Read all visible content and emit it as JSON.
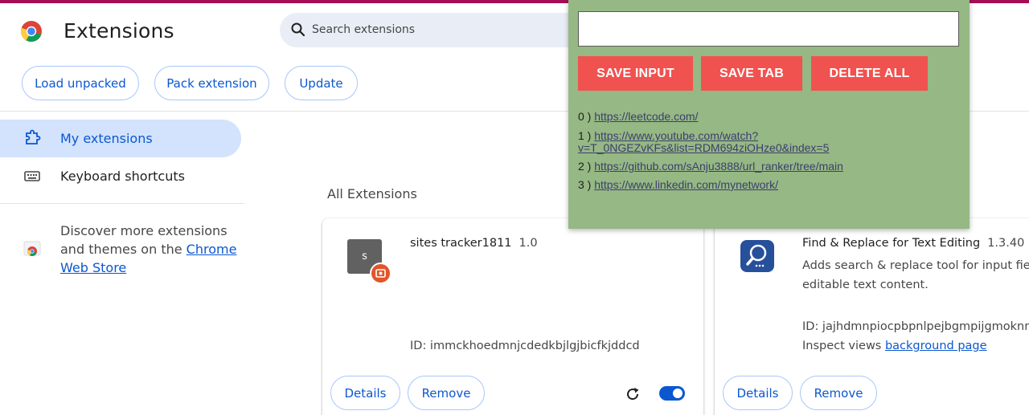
{
  "header": {
    "title": "Extensions",
    "search_placeholder": "Search extensions"
  },
  "toolbar": {
    "load_unpacked": "Load unpacked",
    "pack_extension": "Pack extension",
    "update": "Update"
  },
  "sidebar": {
    "items": [
      {
        "label": "My extensions",
        "icon": "puzzle-icon"
      },
      {
        "label": "Keyboard shortcuts",
        "icon": "keyboard-icon"
      }
    ],
    "discover_prefix": "Discover more extensions and themes on the ",
    "discover_link": "Chrome Web Store"
  },
  "main": {
    "section_title": "All Extensions",
    "cards": [
      {
        "icon_letter": "s",
        "name": "sites tracker1811",
        "version": "1.0",
        "id_text": "ID: immckhoedmnjcdedkbjlgjbicfkjddcd",
        "details": "Details",
        "remove": "Remove",
        "enabled": true
      },
      {
        "name": "Find & Replace for Text Editing",
        "version": "1.3.40",
        "desc_line1": "Adds search & replace tool for input fields",
        "desc_line2": "editable text content.",
        "id_text": "ID: jajhdmnpiocpbpnlpejbgmpijgmoknnl",
        "inspect_prefix": "Inspect views ",
        "inspect_link": "background page",
        "details": "Details",
        "remove": "Remove"
      }
    ]
  },
  "popup": {
    "input_value": "",
    "buttons": [
      "SAVE INPUT",
      "SAVE TAB",
      "DELETE ALL"
    ],
    "links": [
      {
        "index": "0 ) ",
        "url": "https://leetcode.com/"
      },
      {
        "index": "1 ) ",
        "url_line1": "https://www.youtube.com/watch?",
        "url_line2": "v=T_0NGEZvKFs&list=RDM694ziOHze0&index=5"
      },
      {
        "index": "2 ) ",
        "url": "https://github.com/sAnju3888/url_ranker/tree/main"
      },
      {
        "index": "3 ) ",
        "url": "https://www.linkedin.com/mynetwork/"
      }
    ]
  },
  "colors": {
    "accent": "#0b57d0",
    "popup_bg": "#95b884",
    "popup_button": "#f0524f",
    "active_nav": "#d3e3fd"
  }
}
